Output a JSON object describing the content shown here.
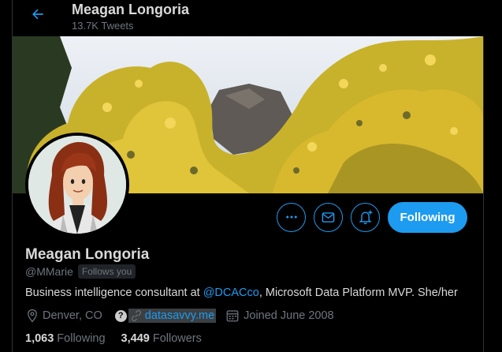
{
  "header": {
    "name": "Meagan Longoria",
    "tweets": "13.7K Tweets"
  },
  "actions": {
    "more_icon": "more-icon",
    "message_icon": "envelope-icon",
    "notify_icon": "bell-plus-icon",
    "follow_label": "Following"
  },
  "profile": {
    "name": "Meagan Longoria",
    "handle": "@MMarie",
    "follows_badge": "Follows you",
    "bio_prefix": "Business intelligence consultant at ",
    "bio_mention": "@DCACco",
    "bio_suffix": ", Microsoft Data Platform MVP. She/her",
    "location": "Denver, CO",
    "help_glyph": "?",
    "website": "datasavvy.me",
    "joined": "Joined June 2008",
    "following_count": "1,063",
    "following_label": "Following",
    "followers_count": "3,449",
    "followers_label": "Followers"
  },
  "colors": {
    "accent": "#1d9bf0",
    "background": "#000000",
    "muted": "#6e767d",
    "text": "#d9d9d9"
  }
}
